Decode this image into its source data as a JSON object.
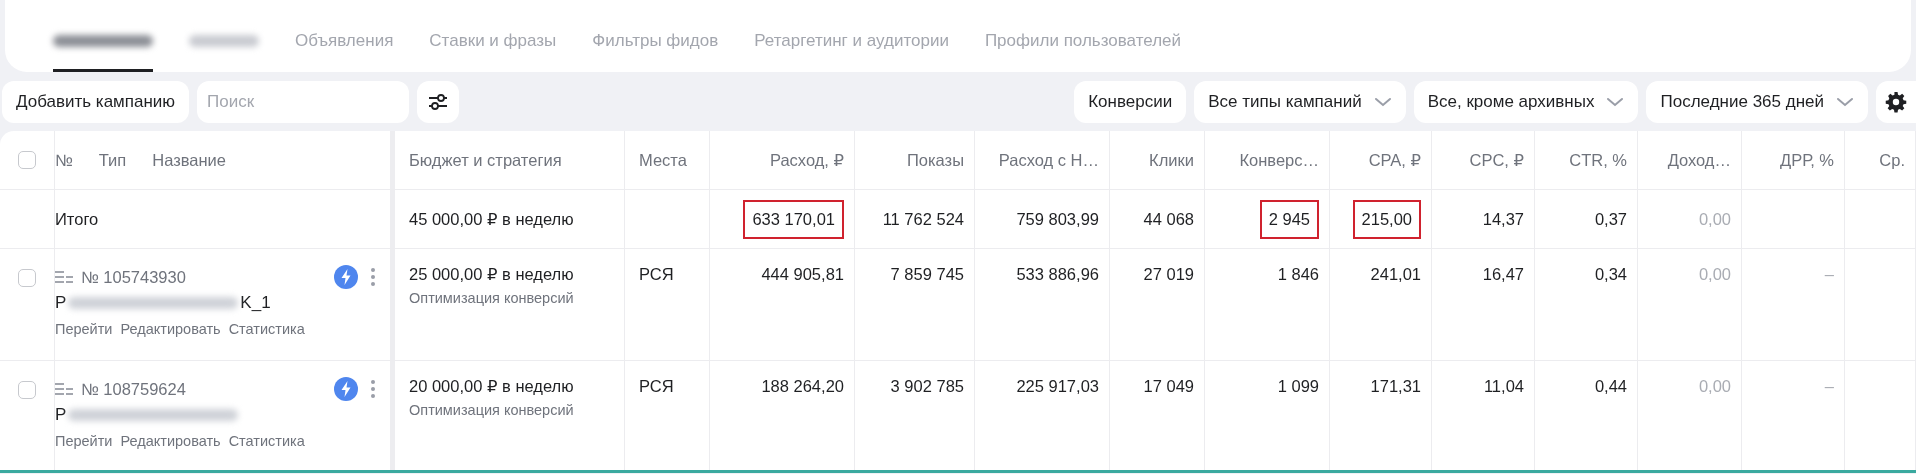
{
  "tabs": [
    {
      "kind": "redacted",
      "selected": true
    },
    {
      "kind": "redacted",
      "selected": false
    },
    {
      "kind": "text",
      "label": "Объявления",
      "selected": false
    },
    {
      "kind": "text",
      "label": "Ставки и фразы",
      "selected": false
    },
    {
      "kind": "text",
      "label": "Фильтры фидов",
      "selected": false
    },
    {
      "kind": "text",
      "label": "Ретаргетинг и аудитории",
      "selected": false
    },
    {
      "kind": "text",
      "label": "Профили пользователей",
      "selected": false
    }
  ],
  "toolbar": {
    "add_button": "Добавить кампанию",
    "search": {
      "placeholder": "Поиск"
    },
    "filters": [
      {
        "label": "Конверсии",
        "dropdown": false
      },
      {
        "label": "Все типы кампаний",
        "dropdown": true
      },
      {
        "label": "Все, кроме архивных",
        "dropdown": true
      },
      {
        "label": "Последние 365 дней",
        "dropdown": true
      }
    ]
  },
  "table": {
    "header_checked": false,
    "left_columns": [
      "№",
      "Тип",
      "Название"
    ],
    "columns": [
      {
        "label": "Бюджет и стратегия",
        "kind": "text"
      },
      {
        "label": "Места",
        "kind": "text"
      },
      {
        "label": "Расход, ₽",
        "kind": "number"
      },
      {
        "label": "Показы",
        "kind": "number"
      },
      {
        "label": "Расход с Н…",
        "kind": "number"
      },
      {
        "label": "Клики",
        "kind": "number"
      },
      {
        "label": "Конверс…",
        "kind": "number"
      },
      {
        "label": "CPA, ₽",
        "kind": "number"
      },
      {
        "label": "CPC, ₽",
        "kind": "number"
      },
      {
        "label": "CTR, %",
        "kind": "number"
      },
      {
        "label": "Доход…",
        "kind": "number"
      },
      {
        "label": "ДРР, %",
        "kind": "number"
      },
      {
        "label": "Ср.",
        "kind": "number"
      }
    ],
    "total": {
      "label": "Итого",
      "cells": [
        {
          "value": "45 000,00 ₽ в неделю",
          "highlighted": false,
          "muted": false
        },
        null,
        {
          "value": "633 170,01",
          "highlighted": true,
          "muted": false
        },
        {
          "value": "11 762 524",
          "highlighted": false,
          "muted": false
        },
        {
          "value": "759 803,99",
          "highlighted": false,
          "muted": false
        },
        {
          "value": "44 068",
          "highlighted": false,
          "muted": false
        },
        {
          "value": "2 945",
          "highlighted": true,
          "muted": false
        },
        {
          "value": "215,00",
          "highlighted": true,
          "muted": false
        },
        {
          "value": "14,37",
          "highlighted": false,
          "muted": false
        },
        {
          "value": "0,37",
          "highlighted": false,
          "muted": false
        },
        {
          "value": "0,00",
          "highlighted": false,
          "muted": true
        }
      ]
    },
    "rows": [
      {
        "checked": false,
        "number": "№ 105743930",
        "name_start": "P",
        "name_end": "K_1",
        "actions": [
          "Перейти",
          "Редактировать",
          "Статистика"
        ],
        "cells": [
          {
            "value": "25 000,00 ₽ в неделю",
            "subtext": "Оптимизация конверсий",
            "muted": false
          },
          {
            "value": "РСЯ",
            "muted": false
          },
          {
            "value": "444 905,81",
            "muted": false
          },
          {
            "value": "7 859 745",
            "muted": false
          },
          {
            "value": "533 886,96",
            "muted": false
          },
          {
            "value": "27 019",
            "muted": false
          },
          {
            "value": "1 846",
            "muted": false
          },
          {
            "value": "241,01",
            "muted": false
          },
          {
            "value": "16,47",
            "muted": false
          },
          {
            "value": "0,34",
            "muted": false
          },
          {
            "value": "0,00",
            "muted": true
          },
          {
            "value": "–",
            "muted": true
          }
        ]
      },
      {
        "checked": false,
        "number": "№ 108759624",
        "name_start": "P",
        "actions": [
          "Перейти",
          "Редактировать",
          "Статистика"
        ],
        "cells": [
          {
            "value": "20 000,00 ₽ в неделю",
            "subtext": "Оптимизация конверсий",
            "muted": false
          },
          {
            "value": "РСЯ",
            "muted": false
          },
          {
            "value": "188 264,20",
            "muted": false
          },
          {
            "value": "3 902 785",
            "muted": false
          },
          {
            "value": "225 917,03",
            "muted": false
          },
          {
            "value": "17 049",
            "muted": false
          },
          {
            "value": "1 099",
            "muted": false
          },
          {
            "value": "171,31",
            "muted": false
          },
          {
            "value": "11,04",
            "muted": false
          },
          {
            "value": "0,44",
            "muted": false
          },
          {
            "value": "0,00",
            "muted": true
          },
          {
            "value": "–",
            "muted": true
          }
        ]
      }
    ]
  }
}
